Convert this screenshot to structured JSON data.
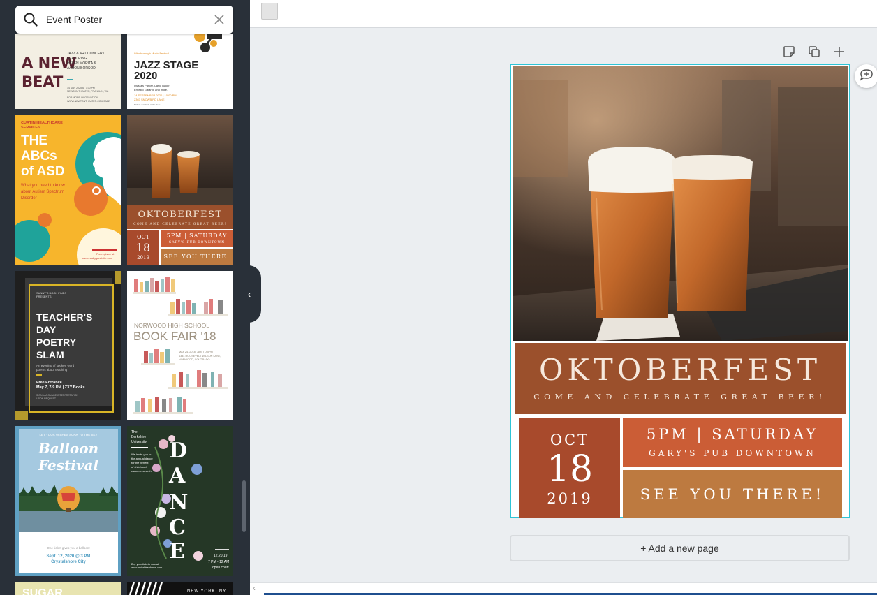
{
  "search": {
    "value": "Event Poster"
  },
  "templates": {
    "new_beat": {
      "title_1": "A NEW",
      "title_2": "BEAT",
      "sub": "JAZZ & ART CONCERT\nFEATURING\nHELEN MORITA &\nAARON BORSODI",
      "date": "14 MAY 2025 AT 7:30 PM\nNEWTON THEATER, FRANKLIN, WA",
      "more": "FOR MORE INFORMATION:\nWWW.NEWTONTHEATER.COM/JAZZ"
    },
    "jazz_stage": {
      "kicker": "Windborough Music Festival",
      "title_1": "JAZZ STAGE",
      "title_2": "2020",
      "names": "Ulysses Parker, Casio Baker,\nErnesto Galang, and more.",
      "date": "14 SEPTEMBER 2020 | 10:00 PM\n2367 SNOWBIRD LANE",
      "note": "Tickets available at the door."
    },
    "abcs": {
      "org_1": "CURTIN HEALTHCARE",
      "org_2": "SERVICES",
      "title_1": "THE",
      "title_2": "ABCs",
      "title_3": "of ASD",
      "sub_1": "What you need to know",
      "sub_2": "about Autism Spectrum",
      "sub_3": "Disorder",
      "reg": "Pre-register at",
      "url": "www.reallygreatsite.com"
    },
    "oktoberfest_thumb": {
      "title": "OKTOBERFEST",
      "sub": "COME AND CELEBRATE GREAT BEER!",
      "month": "OCT",
      "day": "18",
      "year": "2019",
      "time": "5PM | SATURDAY",
      "place": "GARY'S PUB DOWNTOWN",
      "cta": "SEE YOU THERE!"
    },
    "teachers_day": {
      "kicker_1": "SUNNY'S BOOK FINDS",
      "kicker_2": "PRESENTS",
      "title_1": "TEACHER'S",
      "title_2": "DAY",
      "title_3": "POETRY",
      "title_4": "SLAM",
      "desc_1": "An evening of spoken word",
      "desc_2": "poems about teaching",
      "entry": "Free Entrance",
      "when": "May 7, 7-9 PM | ZXY Books",
      "sign": "SIGN LANGUAGE INTERPRETATION",
      "avail": "UPON REQUEST"
    },
    "book_fair": {
      "line_1": "NORWOOD HIGH SCHOOL",
      "line_2": "BOOK FAIR '18",
      "details": "MAY 24, 2018, 7AM TO 5PM\n1344 ROOSEVELT WILSON LANE,\nNORWOOD, COLORADO"
    },
    "balloon": {
      "kicker": "LET YOUR WISHES SOAR TO THE SKY",
      "title_1": "Balloon",
      "title_2": "Festival",
      "tagline": "One ticket gives you a balloon!",
      "date": "Sept. 12, 2020 @ 3 PM",
      "place": "Crystalshore City"
    },
    "dance": {
      "org": "The\nBerkshire\nUniversity",
      "invite": "We invite you to\nthe annual dance\nfor the benefit\nof childhood\ncancer research.",
      "letters": [
        "D",
        "A",
        "N",
        "C",
        "E"
      ],
      "tickets": "Buy your tickets now at\nwww.berkshire.dance.com",
      "date": "12.20.19",
      "time": "7 PM - 12 AM",
      "open": "open court"
    },
    "partial_1": {
      "text": "SUGAR"
    },
    "partial_2": {
      "text": "NEW YORK, NY"
    }
  },
  "collapse_label": "‹",
  "page_tools": [
    "note-icon",
    "duplicate-icon",
    "add-icon"
  ],
  "poster": {
    "title": "OKTOBERFEST",
    "subtitle": "COME AND CELEBRATE GREAT BEER!",
    "month": "OCT",
    "day": "18",
    "year": "2019",
    "time": "5PM | SATURDAY",
    "place": "GARY'S PUB DOWNTOWN",
    "cta": "SEE YOU THERE!",
    "colors": {
      "title_band": "#9b502c",
      "date_block": "#a84a2c",
      "time_block": "#cb5d36",
      "cta_block": "#bd7a40",
      "accent": "#2ec4d6"
    }
  },
  "add_page_label": "+ Add a new page"
}
